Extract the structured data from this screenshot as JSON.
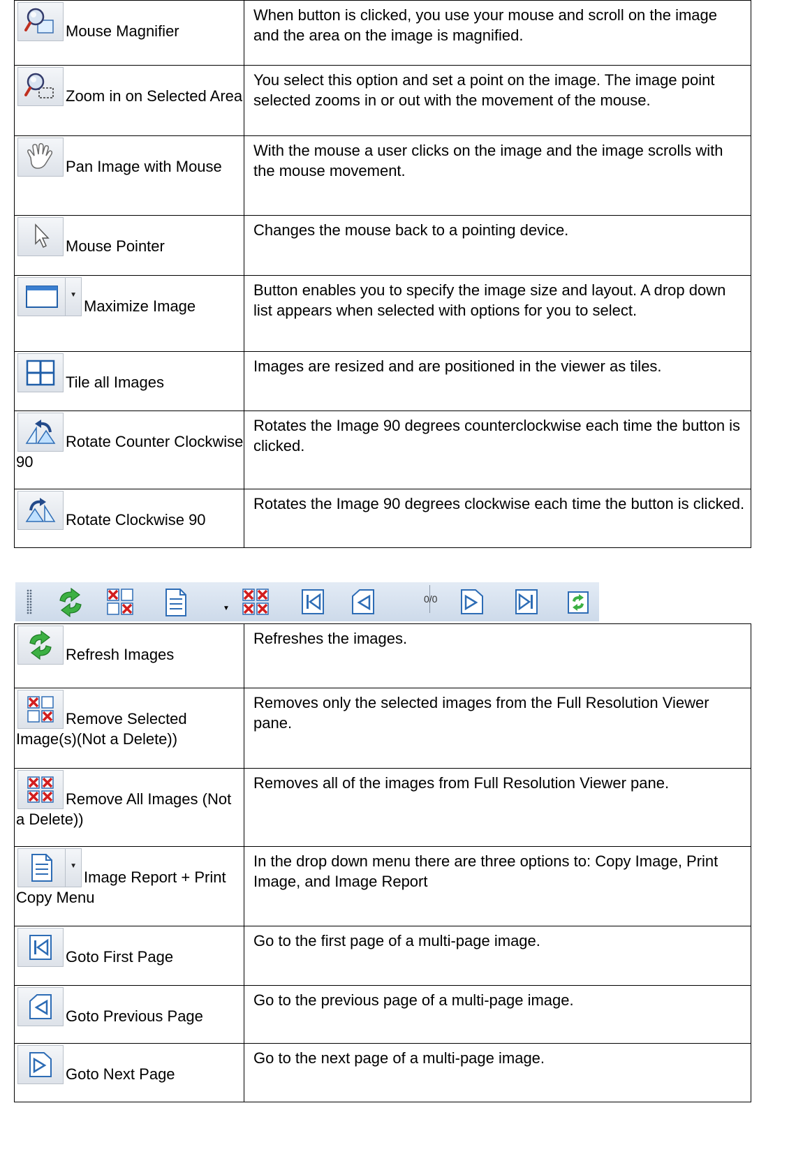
{
  "rows_top": [
    {
      "icon": "magnifier-icon",
      "label": "Mouse Magnifier",
      "desc": "When button is clicked, you use your mouse and scroll on the image and the area on the image is magnified."
    },
    {
      "icon": "zoom-area-icon",
      "label": "Zoom in on Selected Area",
      "desc": "You select this option and set a point on the image. The image point selected zooms in or out with the movement of the mouse."
    },
    {
      "icon": "hand-icon",
      "label": "Pan Image with Mouse",
      "desc": "With the mouse a user clicks on the image and the image scrolls with the mouse movement."
    },
    {
      "icon": "pointer-icon",
      "label": "Mouse Pointer",
      "desc": "Changes the mouse back to a pointing device."
    },
    {
      "icon": "window-icon",
      "label": "Maximize Image",
      "desc": "Button enables you to specify the image size and layout. A drop down list appears when selected with options for you to select."
    },
    {
      "icon": "tile-icon",
      "label": "Tile all Images",
      "desc": "Images are resized and are positioned in the viewer as tiles."
    },
    {
      "icon": "rotate-ccw-icon",
      "label": "Rotate Counter Clockwise 90",
      "desc": "Rotates the Image 90 degrees counterclockwise each time the button is clicked."
    },
    {
      "icon": "rotate-cw-icon",
      "label": "Rotate Clockwise 90",
      "desc": "Rotates the Image 90 degrees clockwise each time the button is clicked."
    }
  ],
  "toolbar": {
    "counter": "0/0",
    "icons": [
      "refresh-icon",
      "remove-selected-icon",
      "report-icon",
      "remove-all-icon",
      "first-page-icon",
      "previous-page-icon",
      "next-page-icon",
      "last-page-icon",
      "refresh-small-icon"
    ]
  },
  "rows_bottom": [
    {
      "icon": "refresh-icon",
      "label": "Refresh Images",
      "desc": "Refreshes the images."
    },
    {
      "icon": "remove-selected-icon",
      "label": "Remove Selected Image(s)(Not a Delete))",
      "desc": "Removes only the selected images from the Full Resolution Viewer pane."
    },
    {
      "icon": "remove-all-icon",
      "label": "Remove All Images (Not a Delete))",
      "desc": "Removes all of the images from Full Resolution Viewer pane."
    },
    {
      "icon": "report-icon",
      "label": "Image Report + Print Copy Menu",
      "desc": "In the drop down menu there are three options to: Copy Image, Print Image, and Image Report"
    },
    {
      "icon": "first-page-icon",
      "label": "Goto First Page",
      "desc": " Go to the first page of a multi-page image."
    },
    {
      "icon": "previous-page-icon",
      "label": "Goto Previous Page",
      "desc": "Go to the previous page of a multi-page image."
    },
    {
      "icon": "next-page-icon",
      "label": "Goto Next Page",
      "desc": "Go to the next page of a multi-page image."
    }
  ]
}
